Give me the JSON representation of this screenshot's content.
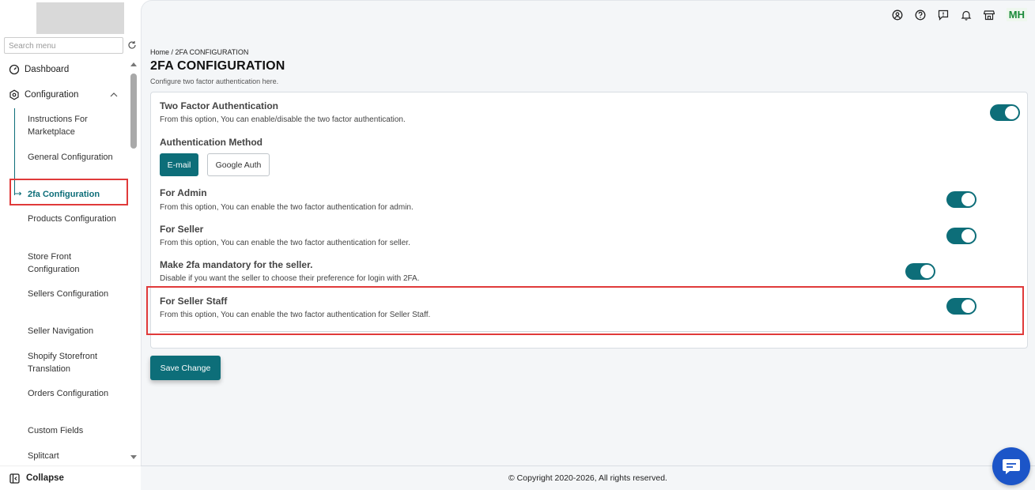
{
  "sidebar": {
    "search_placeholder": "Search menu",
    "dashboard": "Dashboard",
    "configuration": "Configuration",
    "items": [
      "Instructions For Marketplace",
      "General Configuration",
      "2fa Configuration",
      "Products Configuration",
      "Store Front Configuration",
      "Sellers Configuration",
      "Seller Navigation",
      "Shopify Storefront Translation",
      "Orders Configuration",
      "Custom Fields",
      "Splitcart"
    ],
    "active_item": "2fa Configuration",
    "collapse": "Collapse"
  },
  "header": {
    "avatar_initials": "MH"
  },
  "page": {
    "breadcrumb": "Home / 2FA CONFIGURATION",
    "title": "2FA CONFIGURATION",
    "subtitle": "Configure two factor authentication here."
  },
  "settings": {
    "two_factor": {
      "title": "Two Factor Authentication",
      "desc": "From this option, You can enable/disable the two factor authentication.",
      "enabled": true
    },
    "auth_method": {
      "title": "Authentication Method",
      "options": [
        "E-mail",
        "Google Auth"
      ],
      "selected": "E-mail"
    },
    "for_admin": {
      "title": "For Admin",
      "desc": "From this option, You can enable the two factor authentication for admin.",
      "enabled": true
    },
    "for_seller": {
      "title": "For Seller",
      "desc": "From this option, You can enable the two factor authentication for seller.",
      "enabled": true
    },
    "mandatory": {
      "title": "Make 2fa mandatory for the seller.",
      "desc": "Disable if you want the seller to choose their preference for login with 2FA.",
      "enabled": true
    },
    "seller_staff": {
      "title": "For Seller Staff",
      "desc": "From this option, You can enable the two factor authentication for Seller Staff.",
      "enabled": true
    }
  },
  "actions": {
    "save": "Save Change"
  },
  "footer": {
    "copyright": "© Copyright 2020-2026, All rights reserved."
  },
  "colors": {
    "accent": "#0d6e79",
    "highlight": "#e03a3a",
    "chat": "#1c55c8"
  }
}
